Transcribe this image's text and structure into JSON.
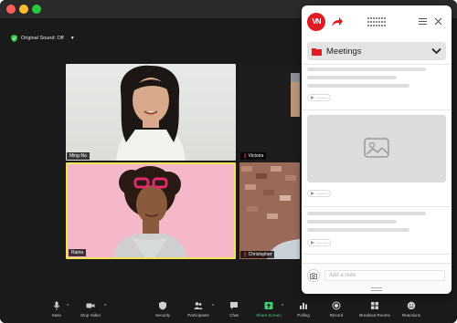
{
  "meeting": {
    "original_sound": "Original Sound: Off",
    "participants": [
      {
        "name": "Ming-Na"
      },
      {
        "name": "Victoria"
      },
      {
        "name": "Raina"
      },
      {
        "name": "Christopher"
      }
    ],
    "active_speaker_color": "#f0e35a"
  },
  "toolbar": {
    "items": [
      {
        "label": "Mute",
        "icon": "microphone-icon"
      },
      {
        "label": "Stop Video",
        "icon": "video-camera-icon"
      },
      {
        "label": "Security",
        "icon": "shield-icon"
      },
      {
        "label": "Participants",
        "icon": "people-icon"
      },
      {
        "label": "Chat",
        "icon": "chat-bubble-icon"
      },
      {
        "label": "Share Screen",
        "icon": "share-screen-icon"
      },
      {
        "label": "Polling",
        "icon": "bar-chart-icon"
      },
      {
        "label": "Record",
        "icon": "record-icon"
      },
      {
        "label": "Breakout Rooms",
        "icon": "grid-icon"
      },
      {
        "label": "Reactions",
        "icon": "smiley-icon"
      }
    ],
    "share_color": "#3cd070"
  },
  "panel": {
    "logo_text": "VN",
    "brand_color": "#e21b23",
    "folder_label": "Meetings",
    "note_placeholder": "Add a note"
  }
}
